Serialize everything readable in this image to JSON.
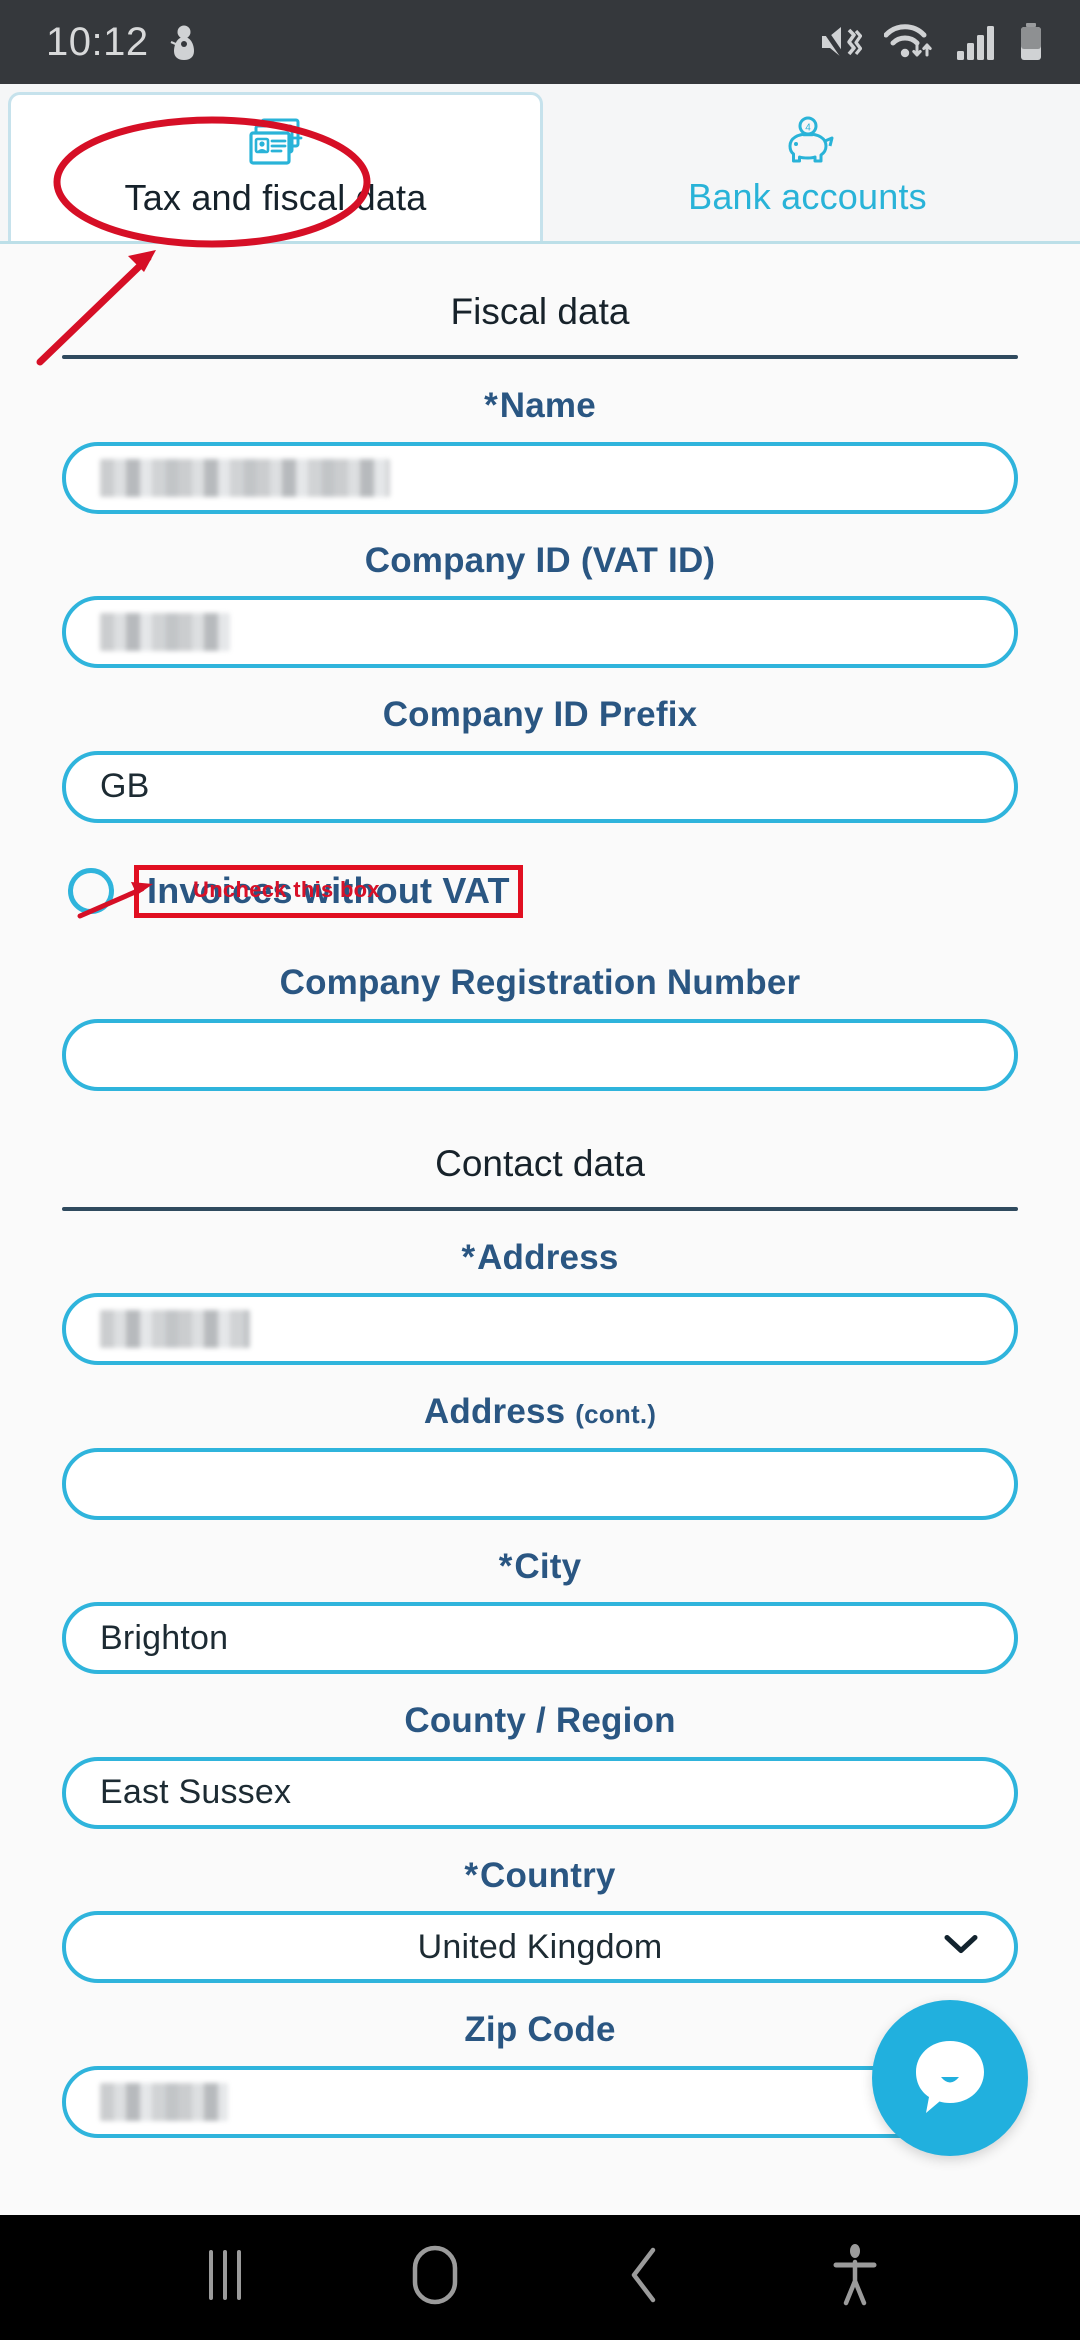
{
  "status_bar": {
    "time": "10:12",
    "icons": [
      "snowman-icon",
      "mute-vibrate-icon",
      "wifi-icon",
      "signal-bars-icon",
      "battery-icon"
    ]
  },
  "tabs": [
    {
      "label": "Tax and fiscal data",
      "icon": "id-card-document-icon",
      "active": true
    },
    {
      "label": "Bank accounts",
      "icon": "piggy-bank-icon",
      "active": false
    }
  ],
  "sections": {
    "fiscal": {
      "title": "Fiscal data"
    },
    "contact": {
      "title": "Contact data"
    }
  },
  "fields": {
    "name": {
      "label": "Name",
      "required_mark": "*",
      "value": "",
      "redacted": true
    },
    "vat_id": {
      "label": "Company ID (VAT ID)",
      "value": "",
      "redacted": true
    },
    "id_prefix": {
      "label": "Company ID Prefix",
      "value": "GB",
      "redacted": false
    },
    "reg_number": {
      "label": "Company Registration Number",
      "value": "",
      "redacted": false
    },
    "address": {
      "label": "Address",
      "required_mark": "*",
      "value": "",
      "redacted": true
    },
    "address_cont": {
      "label": "Address",
      "sub": "(cont.)",
      "value": "",
      "redacted": false
    },
    "city": {
      "label": "City",
      "required_mark": "*",
      "value": "Brighton",
      "redacted": false
    },
    "county": {
      "label": "County / Region",
      "value": "East Sussex",
      "redacted": false
    },
    "country": {
      "label": "Country",
      "required_mark": "*",
      "value": "United Kingdom",
      "redacted": false
    },
    "zip": {
      "label": "Zip Code",
      "value": "",
      "redacted": true
    }
  },
  "checkbox": {
    "label": "Invoices without VAT",
    "checked": false
  },
  "annotations": {
    "uncheck_note": "Uncheck this box",
    "color": "#d81128",
    "tab_highlight": "ellipse-around-tax-and-fiscal-data",
    "arrow_to_tab": "arrow-pointing-to-tax-tab",
    "arrow_to_checkbox": "arrow-pointing-to-checkbox",
    "box_around_checkbox_label": "red-rectangle"
  },
  "chat": {
    "icon": "chat-bubble-icon"
  },
  "nav_bar": {
    "buttons": [
      "recents-icon",
      "home-icon",
      "back-icon",
      "accessibility-icon"
    ]
  },
  "colors": {
    "accent": "#2fb4dc",
    "label": "#2a5682",
    "tab_inactive_text": "#29b3d8",
    "annotation_red": "#d81128",
    "status_bar_bg": "#35383c"
  }
}
